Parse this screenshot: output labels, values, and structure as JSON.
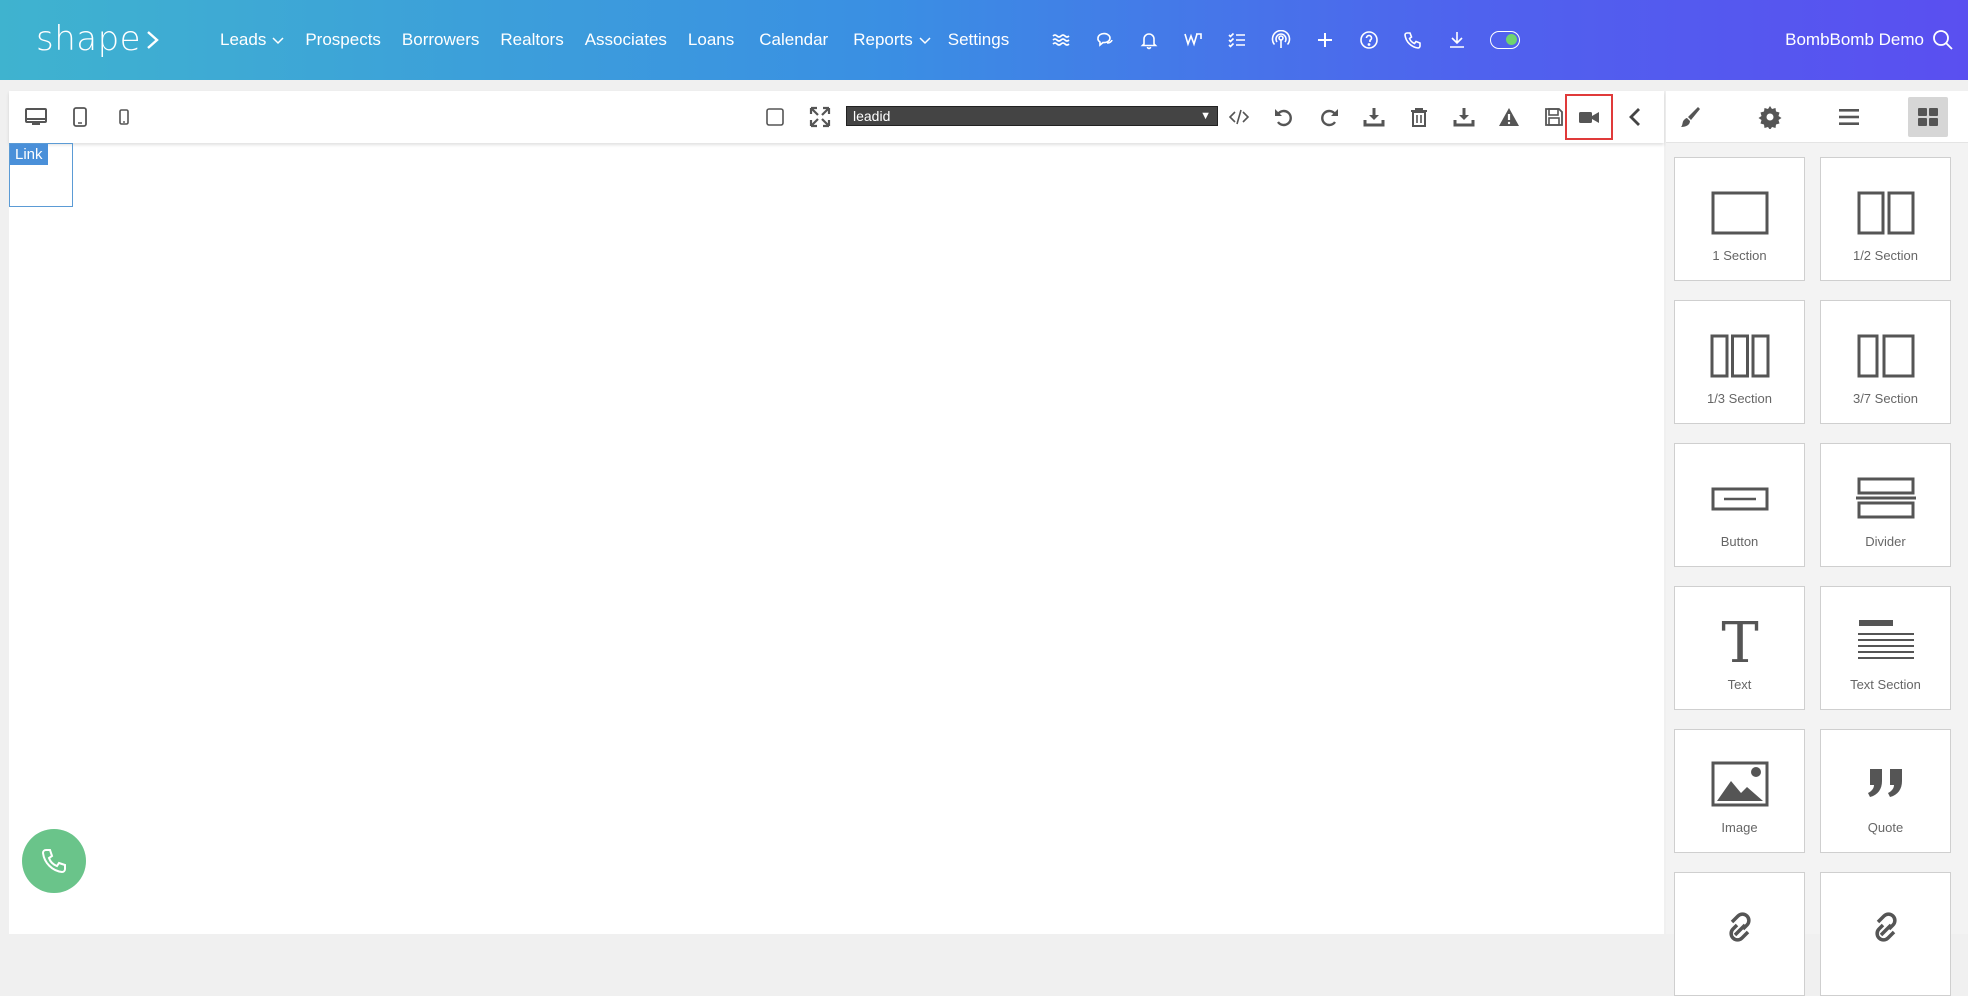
{
  "nav": {
    "logo_text": "shape",
    "links": [
      {
        "label": "Leads",
        "dropdown": true
      },
      {
        "label": "Prospects",
        "dropdown": false
      },
      {
        "label": "Borrowers",
        "dropdown": false
      },
      {
        "label": "Realtors",
        "dropdown": false
      },
      {
        "label": "Associates",
        "dropdown": false
      },
      {
        "label": "Loans",
        "dropdown": false
      },
      {
        "label": "Calendar",
        "dropdown": false
      },
      {
        "label": "Reports",
        "dropdown": true
      },
      {
        "label": "Settings",
        "dropdown": false
      }
    ],
    "icons": [
      "waves-icon",
      "chat-icon",
      "bell-icon",
      "sign-icon",
      "checklist-icon",
      "podcast-icon",
      "plus-icon",
      "help-icon",
      "phone-icon",
      "download-icon"
    ],
    "user_name": "BombBomb Demo"
  },
  "toolbar": {
    "device_icons": [
      "desktop-icon",
      "tablet-icon",
      "mobile-icon"
    ],
    "select_value": "leadid",
    "highlighted": "video-icon"
  },
  "canvas": {
    "link_label": "Link"
  },
  "panel": {
    "tabs": [
      "brush-icon",
      "gear-icon",
      "menu-icon",
      "blocks-icon"
    ],
    "active_tab": "blocks-icon",
    "blocks": [
      {
        "label": "1 Section",
        "icon": "one-section-icon"
      },
      {
        "label": "1/2 Section",
        "icon": "half-section-icon"
      },
      {
        "label": "1/3 Section",
        "icon": "third-section-icon"
      },
      {
        "label": "3/7 Section",
        "icon": "three-seven-section-icon"
      },
      {
        "label": "Button",
        "icon": "button-block-icon"
      },
      {
        "label": "Divider",
        "icon": "divider-block-icon"
      },
      {
        "label": "Text",
        "icon": "text-block-icon"
      },
      {
        "label": "Text Section",
        "icon": "text-section-icon"
      },
      {
        "label": "Image",
        "icon": "image-block-icon"
      },
      {
        "label": "Quote",
        "icon": "quote-block-icon"
      }
    ]
  },
  "colors": {
    "nav_gradient_start": "#3fb3cf",
    "nav_gradient_end": "#5a4ff0",
    "highlight": "#e03a3a",
    "fab": "#6ac48a",
    "link_tag": "#4a90d9"
  }
}
